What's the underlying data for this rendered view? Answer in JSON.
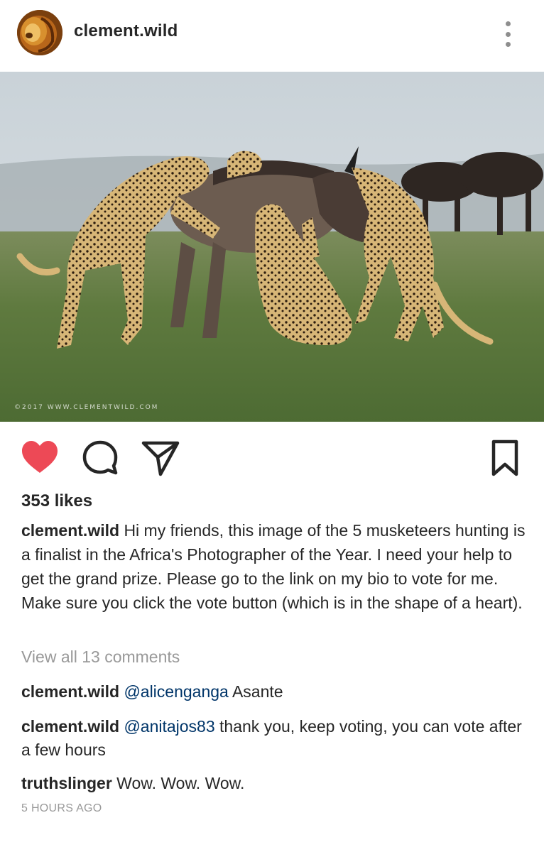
{
  "post": {
    "username": "clement.wild",
    "photo_watermark": "©2017 WWW.CLEMENTWILD.COM",
    "likes": "353 likes",
    "caption": {
      "username": "clement.wild",
      "text": "Hi my friends, this image of the 5 musketeers hunting is a finalist in the Africa's Photographer of the Year. I need your help to get the grand prize. Please go to the link on my bio to vote for me. Make sure you click the vote button (which is in the shape of a heart)."
    },
    "view_all_comments": "View all 13 comments",
    "comments": [
      {
        "username": "clement.wild",
        "mention": "@alicenganga",
        "text": "Asante"
      },
      {
        "username": "clement.wild",
        "mention": "@anitajos83",
        "text": "thank you, keep voting, you can vote after a few hours"
      },
      {
        "username": "truthslinger",
        "mention": "",
        "text": "Wow. Wow. Wow."
      }
    ],
    "timestamp": "5 HOURS AGO"
  },
  "icons": {
    "like": "heart-icon",
    "comment": "comment-bubble-icon",
    "share": "paper-plane-icon",
    "save": "bookmark-icon",
    "more": "more-vertical-icon"
  },
  "colors": {
    "liked_heart": "#ed4956",
    "mention": "#003569",
    "muted_text": "#999999",
    "primary_text": "#262626"
  }
}
